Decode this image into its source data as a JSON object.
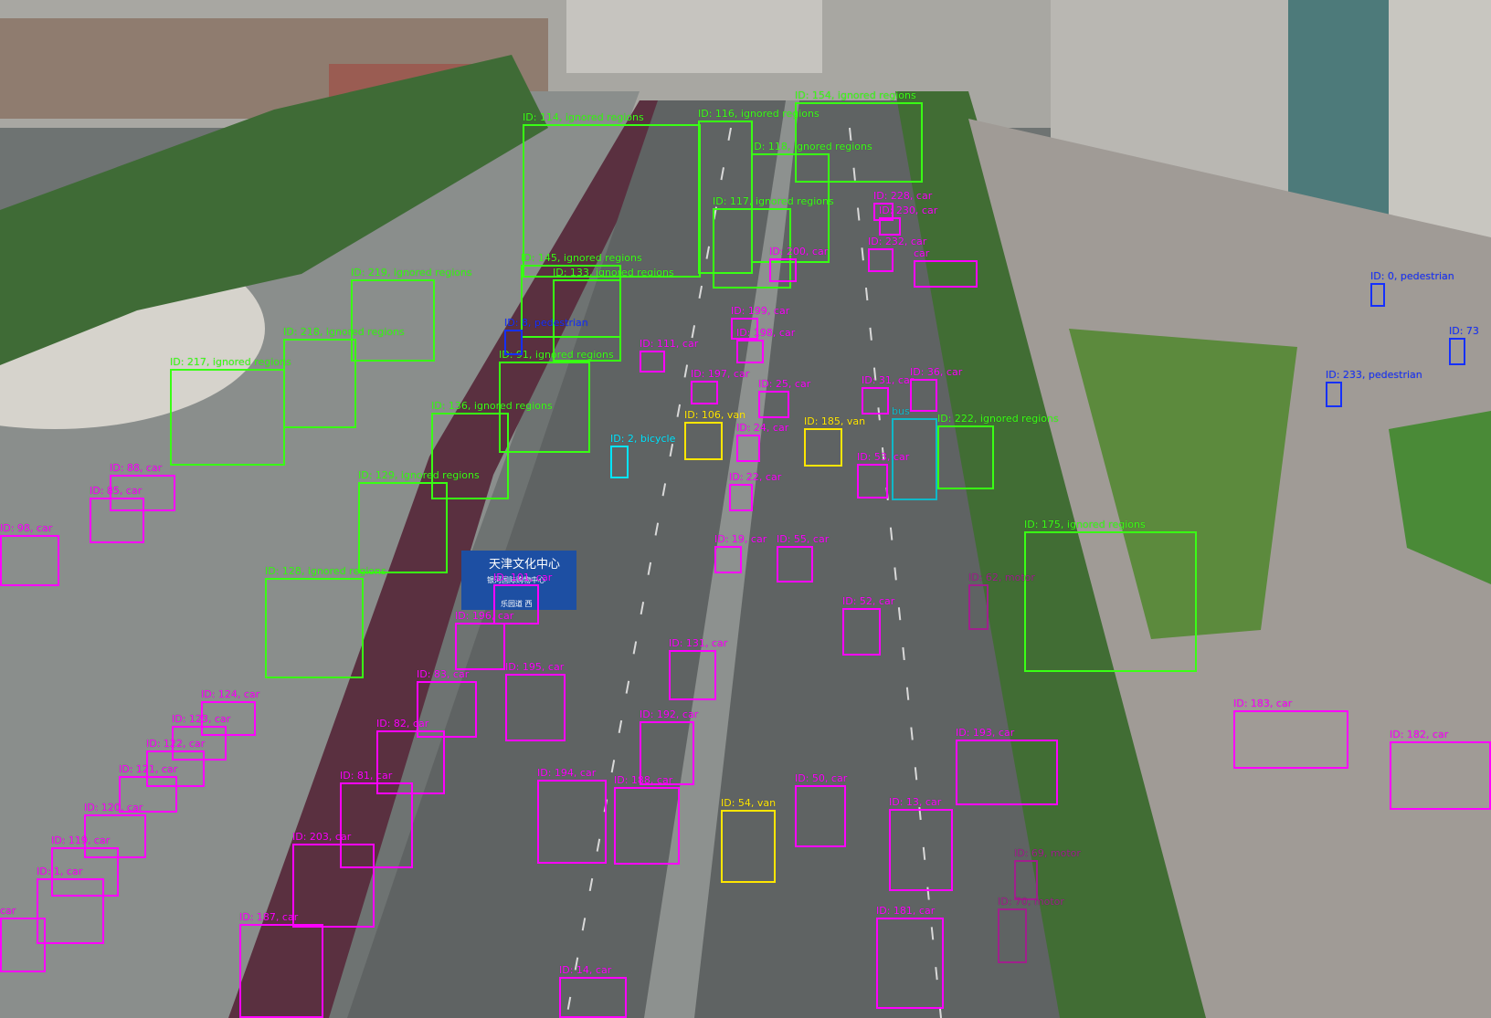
{
  "colors": {
    "car": "#ff00ff",
    "ignored_regions": "#39ff14",
    "pedestrian": "#1530ff",
    "van": "#ffe600",
    "bus": "#10b8c8",
    "bicycle": "#00e5ff",
    "motor": "#a0208c"
  },
  "scene": {
    "signboard_line1": "天津文化中心",
    "signboard_line2": "银河国际购物中心",
    "signboard_line3": "乐园道 西"
  },
  "detections": [
    {
      "label": "ID: 154, ignored regions",
      "cls": "ignored_regions"
    },
    {
      "label": "ID: 114, ignored regions",
      "cls": "ignored_regions"
    },
    {
      "label": "ID: 116, ignored regions",
      "cls": "ignored_regions"
    },
    {
      "label": "ID: 118, ignored regions",
      "cls": "ignored_regions"
    },
    {
      "label": "ID: 117, ignored regions",
      "cls": "ignored_regions"
    },
    {
      "label": "ID: 145, ignored regions",
      "cls": "ignored_regions"
    },
    {
      "label": "ID: 133, ignored regions",
      "cls": "ignored_regions"
    },
    {
      "label": "ID: 219, ignored regions",
      "cls": "ignored_regions"
    },
    {
      "label": "ID: 218, ignored regions",
      "cls": "ignored_regions"
    },
    {
      "label": "ID: 217, ignored regions",
      "cls": "ignored_regions"
    },
    {
      "label": "ID: 91, ignored regions",
      "cls": "ignored_regions"
    },
    {
      "label": "ID: 136, ignored regions",
      "cls": "ignored_regions"
    },
    {
      "label": "ID: 129, ignored regions",
      "cls": "ignored_regions"
    },
    {
      "label": "ID: 128, ignored regions",
      "cls": "ignored_regions"
    },
    {
      "label": "ID: 222, ignored regions",
      "cls": "ignored_regions"
    },
    {
      "label": "ID: 175, ignored regions",
      "cls": "ignored_regions"
    },
    {
      "label": "ID: 8, pedestrian",
      "cls": "pedestrian"
    },
    {
      "label": "ID: 0, pedestrian",
      "cls": "pedestrian"
    },
    {
      "label": "ID: 233, pedestrian",
      "cls": "pedestrian"
    },
    {
      "label": "ID: 73",
      "cls": "pedestrian"
    },
    {
      "label": "ID: 106, van",
      "cls": "van"
    },
    {
      "label": "ID: 185, van",
      "cls": "van"
    },
    {
      "label": "ID: 54, van",
      "cls": "van"
    },
    {
      "label": "bus",
      "cls": "bus"
    },
    {
      "label": "ID: 2, bicycle",
      "cls": "bicycle"
    },
    {
      "label": "ID: 62, motor",
      "cls": "motor"
    },
    {
      "label": "ID: 69, motor",
      "cls": "motor"
    },
    {
      "label": "ID: 70, motor",
      "cls": "motor"
    },
    {
      "label": "ID: 228, car",
      "cls": "car"
    },
    {
      "label": "ID: 230, car",
      "cls": "car"
    },
    {
      "label": "ID: 232, car",
      "cls": "car"
    },
    {
      "label": "ID: 200, car",
      "cls": "car"
    },
    {
      "label": "car",
      "cls": "car"
    },
    {
      "label": "ID: 199, car",
      "cls": "car"
    },
    {
      "label": "ID: 198, car",
      "cls": "car"
    },
    {
      "label": "ID: 111, car",
      "cls": "car"
    },
    {
      "label": "ID: 197, car",
      "cls": "car"
    },
    {
      "label": "ID: 25, car",
      "cls": "car"
    },
    {
      "label": "ID: 31, car",
      "cls": "car"
    },
    {
      "label": "ID: 36, car",
      "cls": "car"
    },
    {
      "label": "ID: 24, car",
      "cls": "car"
    },
    {
      "label": "ID: 22, car",
      "cls": "car"
    },
    {
      "label": "ID: 53, car",
      "cls": "car"
    },
    {
      "label": "ID: 19, car",
      "cls": "car"
    },
    {
      "label": "ID: 55, car",
      "cls": "car"
    },
    {
      "label": "ID: 52, car",
      "cls": "car"
    },
    {
      "label": "ID: 88, car",
      "cls": "car"
    },
    {
      "label": "ID: 85, car",
      "cls": "car"
    },
    {
      "label": "ID: 98, car",
      "cls": "car"
    },
    {
      "label": "ID: 101, car",
      "cls": "car"
    },
    {
      "label": "ID: 196, car",
      "cls": "car"
    },
    {
      "label": "ID: 195, car",
      "cls": "car"
    },
    {
      "label": "ID: 131, car",
      "cls": "car"
    },
    {
      "label": "ID: 124, car",
      "cls": "car"
    },
    {
      "label": "ID: 123, car",
      "cls": "car"
    },
    {
      "label": "ID: 122, car",
      "cls": "car"
    },
    {
      "label": "ID: 121, car",
      "cls": "car"
    },
    {
      "label": "ID: 120, car",
      "cls": "car"
    },
    {
      "label": "ID: 119, car",
      "cls": "car"
    },
    {
      "label": "ID: 1, car",
      "cls": "car"
    },
    {
      "label": "car",
      "cls": "car"
    },
    {
      "label": "ID: 193, car",
      "cls": "car"
    },
    {
      "label": "ID: 192, car",
      "cls": "car"
    },
    {
      "label": "ID: 194, car",
      "cls": "car"
    },
    {
      "label": "ID: 188, car",
      "cls": "car"
    },
    {
      "label": "ID: 50, car",
      "cls": "car"
    },
    {
      "label": "ID: 13, car",
      "cls": "car"
    },
    {
      "label": "ID: 183, car",
      "cls": "car"
    },
    {
      "label": "ID: 182, car",
      "cls": "car"
    },
    {
      "label": "ID: 181, car",
      "cls": "car"
    },
    {
      "label": "ID: 14, car",
      "cls": "car"
    },
    {
      "label": "ID: 187, car",
      "cls": "car"
    },
    {
      "label": "ID: 203, car",
      "cls": "car"
    },
    {
      "label": "ID: 81, car",
      "cls": "car"
    },
    {
      "label": "ID: 82, car",
      "cls": "car"
    },
    {
      "label": "ID: 83, car",
      "cls": "car"
    },
    {
      "label": "ID: 84, car",
      "cls": "car"
    }
  ]
}
